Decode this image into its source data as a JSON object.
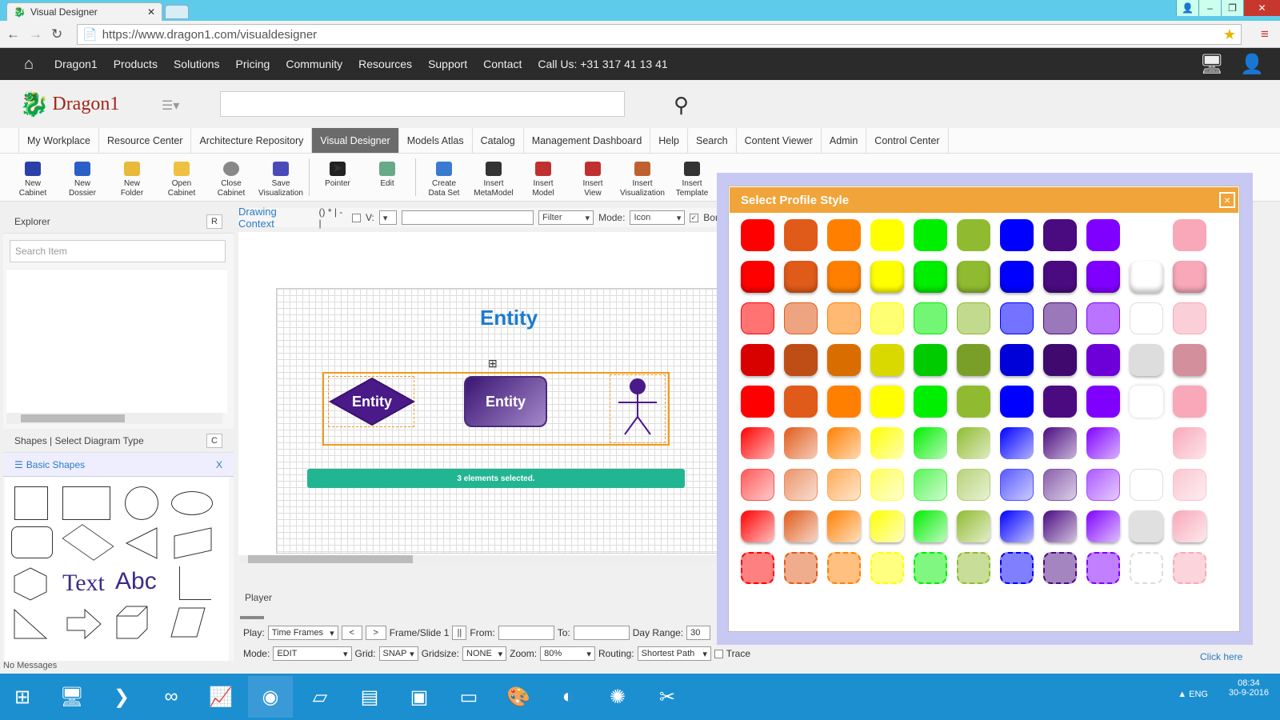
{
  "browser": {
    "tab_title": "Visual Designer",
    "url": "https://www.dragon1.com/visualdesigner"
  },
  "sitenav": {
    "items": [
      "Dragon1",
      "Products",
      "Solutions",
      "Pricing",
      "Community",
      "Resources",
      "Support",
      "Contact",
      "Call Us: +31 317 41 13 41"
    ]
  },
  "logo": "Dragon1",
  "apptabs": [
    "My Workplace",
    "Resource Center",
    "Architecture Repository",
    "Visual Designer",
    "Models Atlas",
    "Catalog",
    "Management Dashboard",
    "Help",
    "Search",
    "Content Viewer",
    "Admin",
    "Control Center"
  ],
  "ribbon": [
    {
      "l1": "New",
      "l2": "Cabinet",
      "color": "#2b3fa8"
    },
    {
      "l1": "New",
      "l2": "Dossier",
      "color": "#2b5fc8"
    },
    {
      "l1": "New",
      "l2": "Folder",
      "color": "#e8b93a"
    },
    {
      "l1": "Open",
      "l2": "Cabinet",
      "color": "#f0c040"
    },
    {
      "l1": "Close",
      "l2": "Cabinet",
      "color": "#888"
    },
    {
      "l1": "Save",
      "l2": "Visualization",
      "color": "#4a4ab8"
    },
    {
      "l1": "Pointer",
      "l2": "",
      "color": "#222"
    },
    {
      "l1": "Edit",
      "l2": "",
      "color": "#6a8"
    },
    {
      "l1": "Create",
      "l2": "Data Set",
      "color": "#3a7ad0"
    },
    {
      "l1": "Insert",
      "l2": "MetaModel",
      "color": "#333"
    },
    {
      "l1": "Insert",
      "l2": "Model",
      "color": "#c03030"
    },
    {
      "l1": "Insert",
      "l2": "View",
      "color": "#c03030"
    },
    {
      "l1": "Insert",
      "l2": "Visualization",
      "color": "#c06030"
    },
    {
      "l1": "Insert",
      "l2": "Template",
      "color": "#333"
    }
  ],
  "explorer": {
    "title": "Explorer",
    "btn": "R",
    "search_placeholder": "Search Item"
  },
  "shapes": {
    "title": "Shapes | Select Diagram Type",
    "btn": "C",
    "category": "Basic Shapes",
    "close": "X",
    "text1": "Text",
    "text2": "Abc"
  },
  "context": {
    "label": "Drawing Context",
    "tail": "() * | - |",
    "v_label": "V:",
    "filter": "Filter",
    "mode_label": "Mode:",
    "mode": "Icon",
    "bor": "Bor"
  },
  "canvas": {
    "title": "Entity",
    "entity1": "Entity",
    "entity2": "Entity",
    "notice": "3 elements selected."
  },
  "player": {
    "title": "Player",
    "play_label": "Play:",
    "play": "Time Frames",
    "prev": "<",
    "next": ">",
    "frame": "Frame/Slide 1",
    "pause": "||",
    "from": "From:",
    "to": "To:",
    "dayrange": "Day Range:",
    "dayval": "30",
    "mode_label": "Mode:",
    "mode": "EDIT",
    "grid_label": "Grid:",
    "grid": "SNAP",
    "gridsize_label": "Gridsize:",
    "gridsize": "NONE",
    "zoom_label": "Zoom:",
    "zoom": "80%",
    "routing_label": "Routing:",
    "routing": "Shortest Path",
    "trace": "Trace"
  },
  "popup": {
    "title": "Select Profile Style",
    "close": "×"
  },
  "palette": {
    "colors": [
      "#ff0000",
      "#e05a1a",
      "#ff8000",
      "#ffff00",
      "#00ee00",
      "#90bb30",
      "#0000ff",
      "#4a0a80",
      "#8000ff",
      "#ffffff",
      "#f8a8b8"
    ]
  },
  "right_link": "Click here",
  "status": "No Messages",
  "taskbar": {
    "time": "08:34",
    "date": "30-9-2016",
    "lang": "ENG"
  }
}
